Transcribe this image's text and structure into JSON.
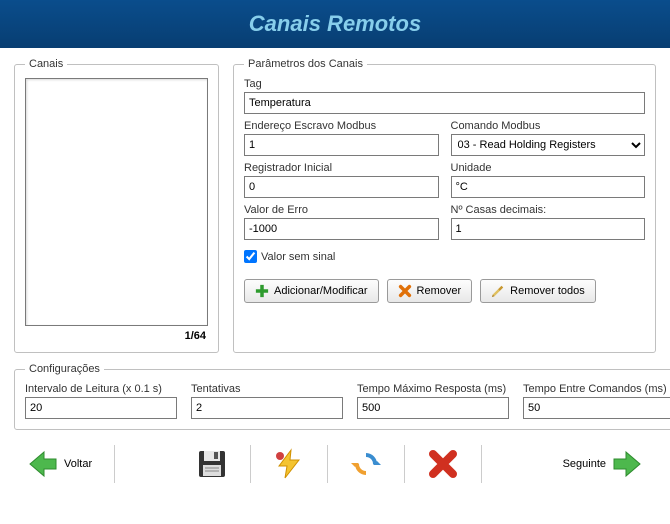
{
  "header": {
    "title": "Canais Remotos"
  },
  "canais": {
    "legend": "Canais",
    "counter": "1/64"
  },
  "params": {
    "legend": "Parâmetros dos Canais",
    "tag_label": "Tag",
    "tag_value": "Temperatura",
    "slave_label": "Endereço Escravo Modbus",
    "slave_value": "1",
    "cmd_label": "Comando Modbus",
    "cmd_value": "03 - Read Holding Registers",
    "reg_label": "Registrador Inicial",
    "reg_value": "0",
    "unit_label": "Unidade",
    "unit_value": "°C",
    "err_label": "Valor de Erro",
    "err_value": "-1000",
    "dec_label": "Nº Casas decimais:",
    "dec_value": "1",
    "unsigned_label": "Valor sem sinal",
    "unsigned_checked": true,
    "btn_add": "Adicionar/Modificar",
    "btn_remove": "Remover",
    "btn_remove_all": "Remover todos"
  },
  "config": {
    "legend": "Configurações",
    "interval_label": "Intervalo de Leitura (x 0.1 s)",
    "interval_value": "20",
    "retries_label": "Tentativas",
    "retries_value": "2",
    "timeout_label": "Tempo Máximo Resposta (ms)",
    "timeout_value": "500",
    "between_label": "Tempo Entre Comandos (ms)",
    "between_value": "50"
  },
  "footer": {
    "back": "Voltar",
    "next": "Seguinte"
  }
}
